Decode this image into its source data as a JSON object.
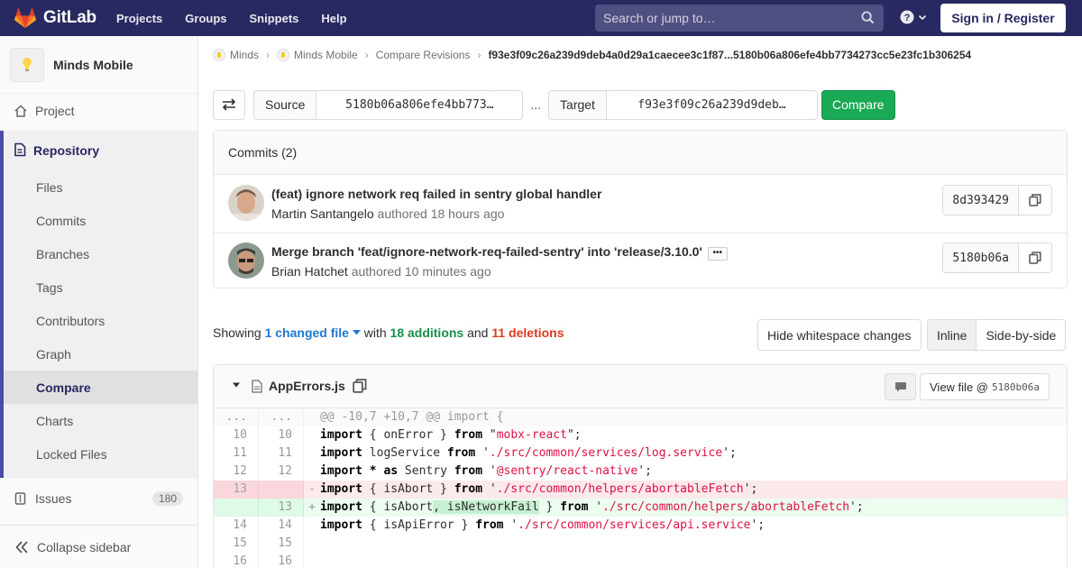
{
  "navbar": {
    "brand": "GitLab",
    "links": [
      "Projects",
      "Groups",
      "Snippets",
      "Help"
    ],
    "search_placeholder": "Search or jump to…",
    "signin_label": "Sign in / Register"
  },
  "sidebar": {
    "project_name": "Minds Mobile",
    "project_label": "Project",
    "repository_label": "Repository",
    "repo_items": [
      "Files",
      "Commits",
      "Branches",
      "Tags",
      "Contributors",
      "Graph",
      "Compare",
      "Charts",
      "Locked Files"
    ],
    "active_item": "Compare",
    "issues_label": "Issues",
    "issues_count": "180",
    "collapse_label": "Collapse sidebar"
  },
  "breadcrumb": [
    "Minds",
    "Minds Mobile",
    "Compare Revisions",
    "f93e3f09c26a239d9deb4a0d29a1caecee3c1f87...5180b06a806efe4bb7734273cc5e23fc1b306254"
  ],
  "compare": {
    "source_label": "Source",
    "source_value": "5180b06a806efe4bb773…",
    "separator": "...",
    "target_label": "Target",
    "target_value": "f93e3f09c26a239d9deb…",
    "button_label": "Compare"
  },
  "commits": {
    "header": "Commits (2)",
    "items": [
      {
        "title": "(feat) ignore network req failed in sentry global handler",
        "author": "Martin Santangelo",
        "meta": "authored 18 hours ago",
        "sha": "8d393429"
      },
      {
        "title": "Merge branch 'feat/ignore-network-req-failed-sentry' into 'release/3.10.0'",
        "author": "Brian Hatchet",
        "meta": "authored 10 minutes ago",
        "sha": "5180b06a"
      }
    ]
  },
  "summary": {
    "showing": "Showing",
    "changed": "1 changed file",
    "with": "with",
    "additions": "18 additions",
    "and": "and",
    "deletions": "11 deletions",
    "whitespace_btn": "Hide whitespace changes",
    "inline_btn": "Inline",
    "side_by_side_btn": "Side-by-side"
  },
  "file": {
    "name": "AppErrors.js",
    "view_file_label": "View file @",
    "view_file_sha": "5180b06a"
  },
  "diff": [
    {
      "type": "match",
      "old": "...",
      "new": "...",
      "mark": "",
      "code": "@@ -10,7 +10,7 @@ import {"
    },
    {
      "type": "ctx",
      "old": "10",
      "new": "10",
      "mark": "",
      "code": "import { onError } from \"mobx-react\";"
    },
    {
      "type": "ctx",
      "old": "11",
      "new": "11",
      "mark": "",
      "code": "import logService from './src/common/services/log.service';"
    },
    {
      "type": "ctx",
      "old": "12",
      "new": "12",
      "mark": "",
      "code": "import * as Sentry from '@sentry/react-native';"
    },
    {
      "type": "old",
      "old": "13",
      "new": "",
      "mark": "-",
      "code": "import { isAbort } from './src/common/helpers/abortableFetch';"
    },
    {
      "type": "new",
      "old": "",
      "new": "13",
      "mark": "+",
      "code": "import { isAbort, isNetworkFail } from './src/common/helpers/abortableFetch';"
    },
    {
      "type": "ctx",
      "old": "14",
      "new": "14",
      "mark": "",
      "code": "import { isApiError } from './src/common/services/api.service';"
    },
    {
      "type": "ctx",
      "old": "15",
      "new": "15",
      "mark": "",
      "code": ""
    },
    {
      "type": "ctx",
      "old": "16",
      "new": "16",
      "mark": "",
      "code": ""
    }
  ],
  "colors": {
    "navbar": "#292961",
    "compare_button": "#1aaa55",
    "additions": "#168f48",
    "deletions": "#db3b21",
    "link": "#1f78d1"
  }
}
